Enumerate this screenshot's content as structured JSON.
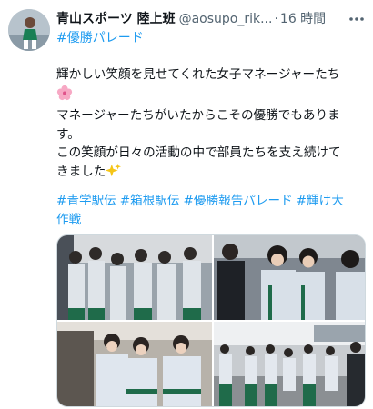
{
  "tweet": {
    "author_name": "青山スポーツ 陸上班",
    "author_handle": "@aosupo_rik...",
    "separator": "·",
    "timestamp": "16 時間",
    "tag_line": "#優勝パレード",
    "body": [
      "輝かしい笑顔を見せてくれた女子マネージャーたち",
      "マネージャーたちがいたからこその優勝でもありま",
      "す。",
      "この笑顔が日々の活動の中で部員たちを支え続けて",
      "きました"
    ],
    "hashtags": [
      "#青学駅伝",
      "#箱根駅伝",
      "#優勝報告パレード",
      "#輝け大",
      "作戦"
    ]
  },
  "icons": {
    "avatar": "runner-avatar",
    "more": "more-options-icon",
    "emoji_1": "cherry-blossom-icon",
    "emoji_2": "sparkles-icon"
  },
  "colors": {
    "link": "#1d9bf0",
    "text": "#0f1419",
    "muted": "#536471",
    "jacket": "#c9d2dc",
    "jacket_trim": "#1f6b4a"
  }
}
